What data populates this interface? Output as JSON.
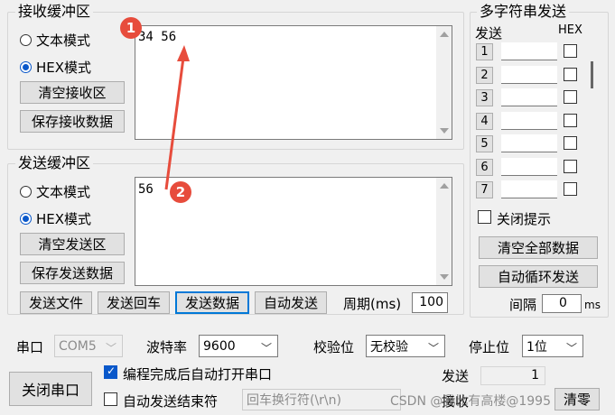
{
  "receive_buffer": {
    "title": "接收缓冲区",
    "mode_text": "文本模式",
    "mode_hex": "HEX模式",
    "selected_mode": "hex",
    "clear_btn": "清空接收区",
    "save_btn": "保存接收数据",
    "content": "34 56"
  },
  "send_buffer": {
    "title": "发送缓冲区",
    "mode_text": "文本模式",
    "mode_hex": "HEX模式",
    "selected_mode": "hex",
    "clear_btn": "清空发送区",
    "save_btn": "保存发送数据",
    "content": "56"
  },
  "send_toolbar": {
    "send_file": "发送文件",
    "send_enter": "发送回车",
    "send_data": "发送数据",
    "auto_send": "自动发送",
    "period_label": "周期(ms)",
    "period_value": "100"
  },
  "multi_string": {
    "title": "多字符串发送",
    "col_send": "发送",
    "col_hex": "HEX",
    "rows": [
      "1",
      "2",
      "3",
      "4",
      "5",
      "6",
      "7"
    ],
    "close_hint": "关闭提示",
    "clear_all": "清空全部数据",
    "auto_loop": "自动循环发送",
    "interval_label": "间隔",
    "interval_value": "0",
    "interval_unit": "ms"
  },
  "serial": {
    "port_label": "串口",
    "port_value": "COM5",
    "baud_label": "波特率",
    "baud_value": "9600",
    "parity_label": "校验位",
    "parity_value": "无校验",
    "stop_label": "停止位",
    "stop_value": "1位",
    "close_port": "关闭串口",
    "auto_open": "编程完成后自动打开串口",
    "auto_end": "自动发送结束符",
    "end_char": "回车换行符(\\r\\n)",
    "send_label": "发送",
    "send_count": "1",
    "recv_label": "接收",
    "clear_label": "清零"
  },
  "annotations": {
    "marker1": "1",
    "marker2": "2",
    "watermark": "CSDN @我比有高楼@1995",
    "color": "#e74c3c"
  }
}
